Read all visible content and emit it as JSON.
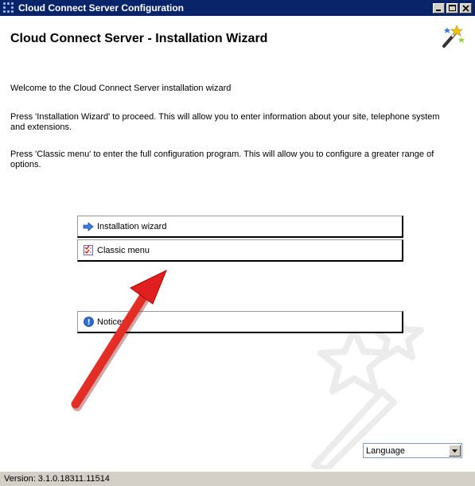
{
  "window": {
    "title": "Cloud Connect Server Configuration"
  },
  "header": {
    "title": "Cloud Connect Server - Installation Wizard"
  },
  "body": {
    "welcome": "Welcome to the Cloud Connect Server installation wizard",
    "wizard_hint": "Press 'Installation Wizard' to proceed. This will allow you to enter information about your site, telephone system and extensions.",
    "classic_hint": "Press 'Classic menu' to enter the full configuration program. This will allow you to configure a greater range of options."
  },
  "buttons": {
    "installation_wizard": {
      "label": "Installation wizard",
      "icon": "arrow-right-icon"
    },
    "classic_menu": {
      "label": "Classic menu",
      "icon": "checklist-icon"
    },
    "notices": {
      "label": "Notices",
      "icon": "info-icon"
    }
  },
  "language": {
    "selected": "Language"
  },
  "status": {
    "version": "Version: 3.1.0.18311.11514"
  },
  "colors": {
    "titlebar": "#0a246a",
    "annotation_arrow": "#e02020"
  }
}
